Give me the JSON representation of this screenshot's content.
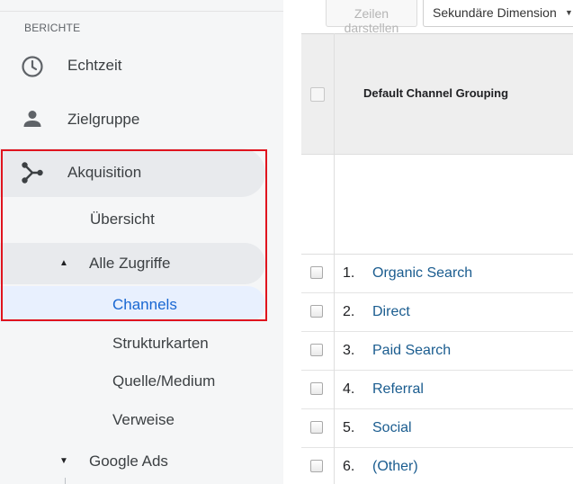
{
  "sidebar": {
    "section_label": "BERICHTE",
    "items": {
      "echtzeit": {
        "label": "Echtzeit",
        "icon": "clock-icon"
      },
      "zielgruppe": {
        "label": "Zielgruppe",
        "icon": "person-icon"
      },
      "akquisition": {
        "label": "Akquisition",
        "icon": "acquisition-icon"
      },
      "uebersicht": {
        "label": "Übersicht"
      },
      "alle_zugriffe": {
        "label": "Alle Zugriffe",
        "expanded": true
      },
      "channels": {
        "label": "Channels",
        "selected": true
      },
      "strukturkarten": {
        "label": "Strukturkarten"
      },
      "quelle_medium": {
        "label": "Quelle/Medium"
      },
      "verweise": {
        "label": "Verweise"
      },
      "google_ads": {
        "label": "Google Ads",
        "expanded": false
      }
    },
    "highlight_color": "#e0141e",
    "selected_color": "#1967d2"
  },
  "toolbar": {
    "rows_button_label": "Zeilen darstellen",
    "secondary_dimension_label": "Sekundäre Dimension"
  },
  "table": {
    "column_header": "Default Channel Grouping",
    "rows": [
      {
        "num": "1.",
        "channel": "Organic Search"
      },
      {
        "num": "2.",
        "channel": "Direct"
      },
      {
        "num": "3.",
        "channel": "Paid Search"
      },
      {
        "num": "4.",
        "channel": "Referral"
      },
      {
        "num": "5.",
        "channel": "Social"
      },
      {
        "num": "6.",
        "channel": "(Other)"
      }
    ],
    "link_color": "#1a5c8f"
  }
}
